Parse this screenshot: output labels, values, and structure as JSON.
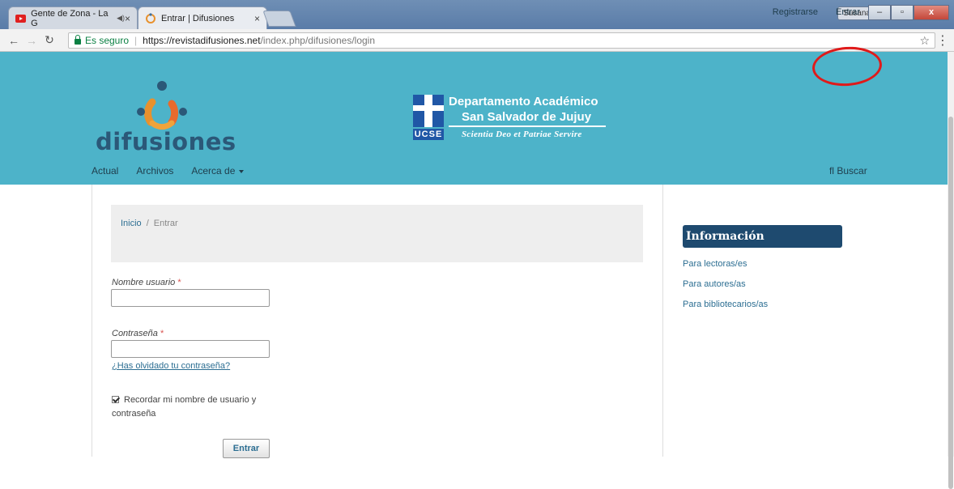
{
  "browser": {
    "tabs": [
      {
        "title": "Gente de Zona - La G",
        "active": false
      },
      {
        "title": "Entrar | Difusiones",
        "active": true
      }
    ],
    "user_badge": "Susana",
    "secure_label": "Es seguro",
    "url_scheme_host": "https://revistadifusiones.net",
    "url_path": "/index.php/difusiones/login"
  },
  "header": {
    "top_links": {
      "register": "Registrarse",
      "login": "Entrar"
    },
    "logo_text": "difusiones",
    "dept": {
      "line1": "Departamento Académico",
      "line2": "San Salvador de Jujuy",
      "motto": "Scientia Deo et Patriae Servire",
      "ucse": "UCSE"
    },
    "nav": {
      "current": "Actual",
      "archives": "Archivos",
      "about": "Acerca de"
    },
    "search": "Buscar"
  },
  "breadcrumb": {
    "home": "Inicio",
    "separator": "/",
    "current": "Entrar"
  },
  "form": {
    "username_label": "Nombre usuario",
    "password_label": "Contraseña",
    "required_mark": "*",
    "forgot_link": "¿Has olvidado tu contraseña?",
    "remember_label": "Recordar mi nombre de usuario y contraseña",
    "remember_checked": true,
    "submit_label": "Entrar"
  },
  "sidebar": {
    "title": "Información",
    "links": [
      "Para lectoras/es",
      "Para autores/as",
      "Para bibliotecarios/as"
    ]
  },
  "colors": {
    "header_bg": "#4db3c9",
    "sidebar_title_bg": "#1e4a6f",
    "link": "#2c6e92",
    "highlight": "#e01a1a"
  }
}
